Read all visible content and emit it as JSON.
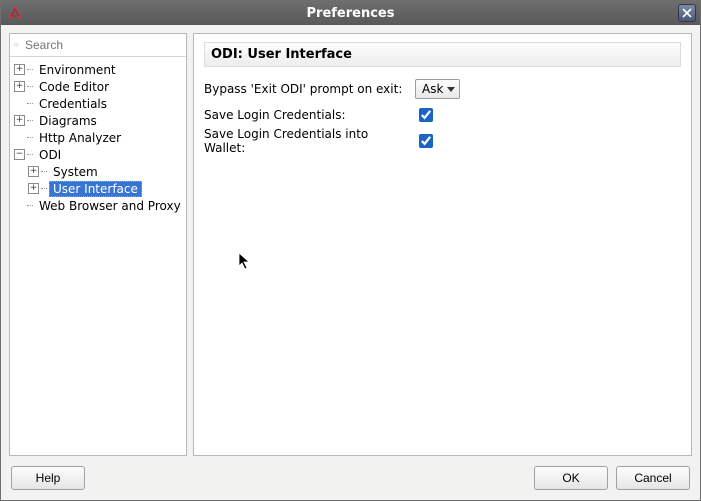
{
  "window": {
    "title": "Preferences"
  },
  "search": {
    "placeholder": "Search"
  },
  "tree": {
    "items": [
      {
        "label": "Environment",
        "expandable": true,
        "expanded": false
      },
      {
        "label": "Code Editor",
        "expandable": true,
        "expanded": false
      },
      {
        "label": "Credentials",
        "expandable": false
      },
      {
        "label": "Diagrams",
        "expandable": true,
        "expanded": false
      },
      {
        "label": "Http Analyzer",
        "expandable": false
      },
      {
        "label": "ODI",
        "expandable": true,
        "expanded": true,
        "children": [
          {
            "label": "System",
            "expandable": true,
            "expanded": false
          },
          {
            "label": "User Interface",
            "expandable": true,
            "expanded": false,
            "selected": true
          }
        ]
      },
      {
        "label": "Web Browser and Proxy",
        "expandable": false
      }
    ]
  },
  "panel": {
    "title": "ODI: User Interface",
    "row1_label": "Bypass 'Exit ODI' prompt on exit:",
    "row1_value": "Ask",
    "row2_label": "Save Login Credentials:",
    "row2_checked": true,
    "row3_label": "Save Login Credentials into Wallet:",
    "row3_checked": true
  },
  "buttons": {
    "help": "Help",
    "ok": "OK",
    "cancel": "Cancel"
  }
}
